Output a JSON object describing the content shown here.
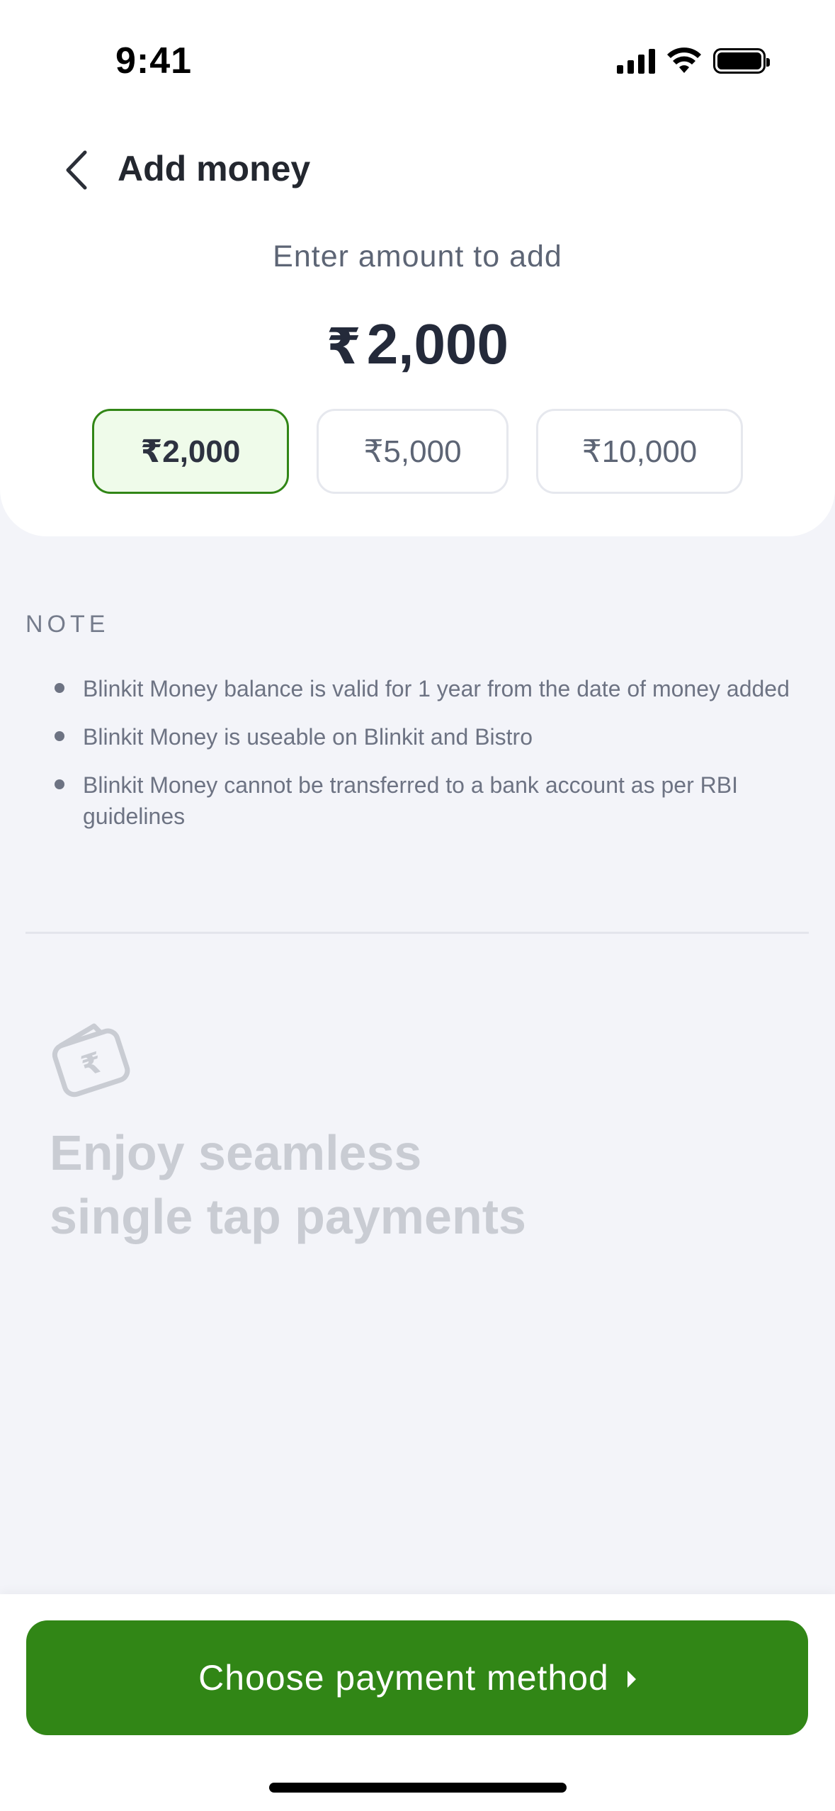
{
  "status_bar": {
    "time": "9:41"
  },
  "header": {
    "title": "Add money"
  },
  "amount_section": {
    "label": "Enter amount to add",
    "currency_symbol": "₹",
    "amount": "2,000",
    "chips": [
      {
        "label": "₹2,000",
        "selected": true
      },
      {
        "label": "₹5,000",
        "selected": false
      },
      {
        "label": "₹10,000",
        "selected": false
      }
    ]
  },
  "note": {
    "heading": "NOTE",
    "items": [
      "Blinkit Money balance is valid for 1 year from the date of money added",
      "Blinkit Money is useable on Blinkit and Bistro",
      "Blinkit Money cannot be transferred to a bank account as per RBI guidelines"
    ]
  },
  "promo": {
    "icon": "wallet-rupee-icon",
    "line1": "Enjoy seamless",
    "line2": "single tap payments"
  },
  "cta": {
    "label": "Choose payment method"
  },
  "colors": {
    "brand_green": "#318616",
    "selected_chip_bg": "#effbea",
    "background": "#f3f4f9"
  }
}
